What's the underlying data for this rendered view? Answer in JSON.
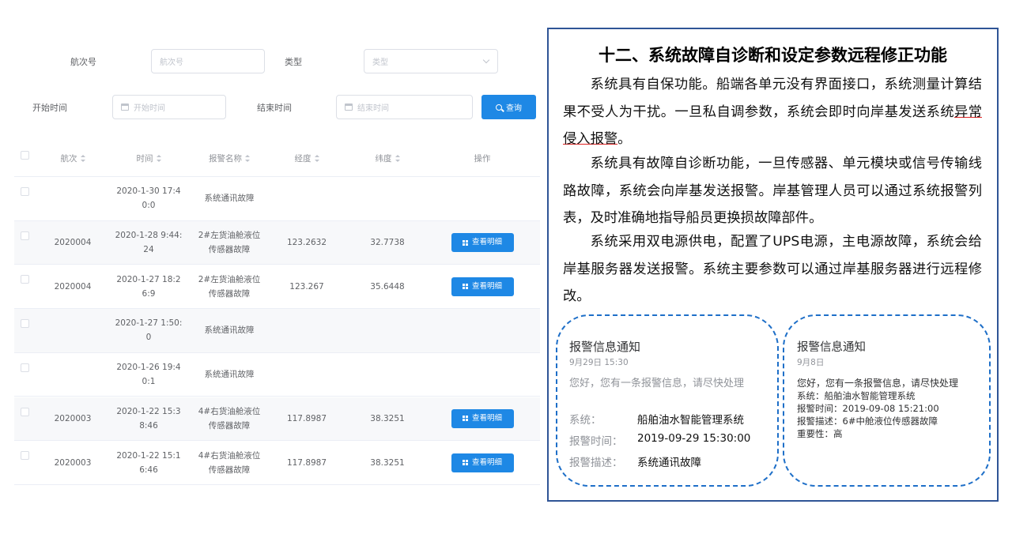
{
  "search": {
    "voyage_label": "航次号",
    "voyage_placeholder": "航次号",
    "type_label": "类型",
    "type_placeholder": "类型",
    "start_label": "开始时间",
    "start_placeholder": "开始时间",
    "end_label": "结束时间",
    "end_placeholder": "结束时间",
    "query_button": "查询"
  },
  "table": {
    "columns": [
      "航次",
      "时间",
      "报警名称",
      "经度",
      "纬度",
      "操作"
    ],
    "rows": [
      {
        "voyage": "",
        "time": "2020-1-30 17:40:0",
        "time_l1": "2020-1-30 17:4",
        "time_l2": "0:0",
        "alarm_l1": "系统通讯故障",
        "alarm_l2": "",
        "lon": "",
        "lat": "",
        "action": ""
      },
      {
        "voyage": "2020004",
        "time_l1": "2020-1-28 9:44:",
        "time_l2": "24",
        "alarm_l1": "2#左货油舱液位",
        "alarm_l2": "传感器故障",
        "lon": "123.2632",
        "lat": "32.7738",
        "action": "查看明细"
      },
      {
        "voyage": "2020004",
        "time_l1": "2020-1-27 18:2",
        "time_l2": "6:9",
        "alarm_l1": "2#左货油舱液位",
        "alarm_l2": "传感器故障",
        "lon": "123.267",
        "lat": "35.6448",
        "action": "查看明细"
      },
      {
        "voyage": "",
        "time_l1": "2020-1-27 1:50:",
        "time_l2": "0",
        "alarm_l1": "系统通讯故障",
        "alarm_l2": "",
        "lon": "",
        "lat": "",
        "action": ""
      },
      {
        "voyage": "",
        "time_l1": "2020-1-26 19:4",
        "time_l2": "0:1",
        "alarm_l1": "系统通讯故障",
        "alarm_l2": "",
        "lon": "",
        "lat": "",
        "action": ""
      },
      {
        "voyage": "2020003",
        "time_l1": "2020-1-22 15:3",
        "time_l2": "8:46",
        "alarm_l1": "4#右货油舱液位",
        "alarm_l2": "传感器故障",
        "lon": "117.8987",
        "lat": "38.3251",
        "action": "查看明细"
      },
      {
        "voyage": "2020003",
        "time_l1": "2020-1-22 15:1",
        "time_l2": "6:46",
        "alarm_l1": "4#右货油舱液位",
        "alarm_l2": "传感器故障",
        "lon": "117.8987",
        "lat": "38.3251",
        "action": "查看明细"
      }
    ]
  },
  "panel": {
    "title": "十二、系统故障自诊断和设定参数远程修正功能",
    "p1_before": "系统具有自保功能。船端各单元没有界面接口，系统测量计算结果不受人为干扰。一旦私自调参数，系统会即时向岸基发送系统",
    "p1_underline": "异常侵入报警",
    "p1_after": "。",
    "p2": "系统具有故障自诊断功能，一旦传感器、单元模块或信号传输线路故障，系统会向岸基发送报警。岸基管理人员可以通过系统报警列表，及时准确地指导船员更换损故障部件。",
    "p3": "系统采用双电源供电，配置了UPS电源，主电源故障，系统会给岸基服务器发送报警。系统主要参数可以通过岸基服务器进行远程修改。"
  },
  "notice1": {
    "title": "报警信息通知",
    "date": "9月29日  15:30",
    "greeting": "您好，您有一条报警信息，请尽快处理",
    "k_system": "系统：",
    "v_system": "船舶油水智能管理系统",
    "k_time": "报警时间：",
    "v_time": "2019-09-29 15:30:00",
    "k_desc": "报警描述：",
    "v_desc": "系统通讯故障"
  },
  "notice2": {
    "title": "报警信息通知",
    "date": "9月8日",
    "greeting": "您好，您有一条报警信息，请尽快处理",
    "line1": "系统：船舶油水智能管理系统",
    "line2": "报警时间：2019-09-08 15:21:00",
    "line3": "报警描述：6#中舱液位传感器故障",
    "line4": "重要性：高"
  }
}
